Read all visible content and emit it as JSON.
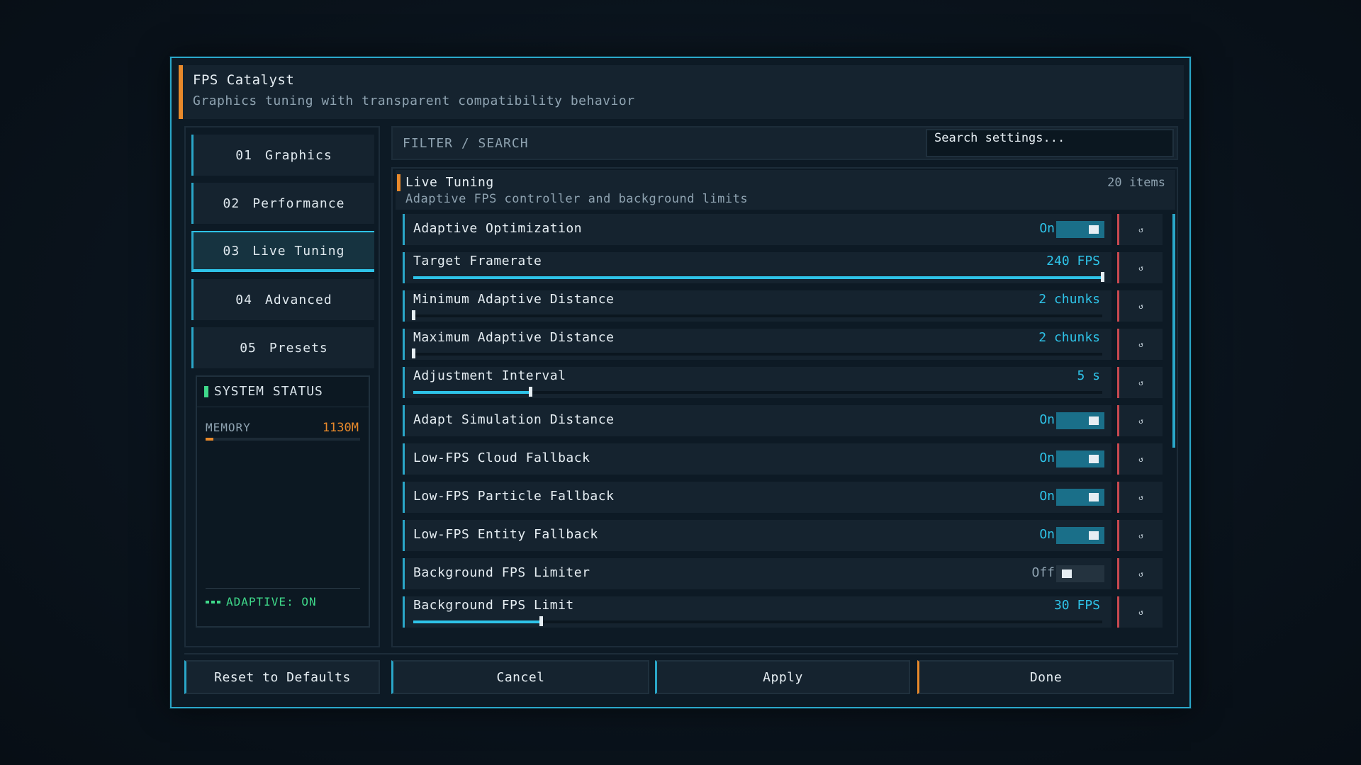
{
  "window": {
    "title": "FPS Catalyst",
    "subtitle": "Graphics tuning with transparent compatibility behavior"
  },
  "sidebar": {
    "items": [
      {
        "num": "01",
        "label": "Graphics"
      },
      {
        "num": "02",
        "label": "Performance"
      },
      {
        "num": "03",
        "label": "Live Tuning",
        "active": true
      },
      {
        "num": "04",
        "label": "Advanced"
      },
      {
        "num": "05",
        "label": "Presets"
      }
    ],
    "status": {
      "title": "SYSTEM STATUS",
      "memory_label": "MEMORY",
      "memory_value": "1130M",
      "memory_fraction": 0.05,
      "adaptive_label": "ADAPTIVE: ON"
    }
  },
  "filter": {
    "label": "FILTER / SEARCH",
    "placeholder": "Search settings..."
  },
  "section": {
    "title": "Live Tuning",
    "subtitle": "Adaptive FPS controller and background limits",
    "count": "20 items"
  },
  "settings": [
    {
      "label": "Adaptive Optimization",
      "value": "On",
      "type": "toggle",
      "on": true
    },
    {
      "label": "Target Framerate",
      "value": "240 FPS",
      "type": "slider",
      "fraction": 1.0
    },
    {
      "label": "Minimum Adaptive Distance",
      "value": "2 chunks",
      "type": "slider",
      "fraction": 0.0
    },
    {
      "label": "Maximum Adaptive Distance",
      "value": "2 chunks",
      "type": "slider",
      "fraction": 0.0
    },
    {
      "label": "Adjustment Interval",
      "value": "5 s",
      "type": "slider",
      "fraction": 0.17
    },
    {
      "label": "Adapt Simulation Distance",
      "value": "On",
      "type": "toggle",
      "on": true
    },
    {
      "label": "Low-FPS Cloud Fallback",
      "value": "On",
      "type": "toggle",
      "on": true
    },
    {
      "label": "Low-FPS Particle Fallback",
      "value": "On",
      "type": "toggle",
      "on": true
    },
    {
      "label": "Low-FPS Entity Fallback",
      "value": "On",
      "type": "toggle",
      "on": true
    },
    {
      "label": "Background FPS Limiter",
      "value": "Off",
      "type": "toggle",
      "on": false
    },
    {
      "label": "Background FPS Limit",
      "value": "30 FPS",
      "type": "slider",
      "fraction": 0.185
    }
  ],
  "reset_glyph": "↺",
  "footer": {
    "reset": "Reset to Defaults",
    "cancel": "Cancel",
    "apply": "Apply",
    "done": "Done"
  },
  "colors": {
    "accent": "#2aa6c8",
    "highlight": "#2ec3e8",
    "orange": "#e8892b",
    "green": "#3fd98a",
    "red": "#c8484f"
  }
}
